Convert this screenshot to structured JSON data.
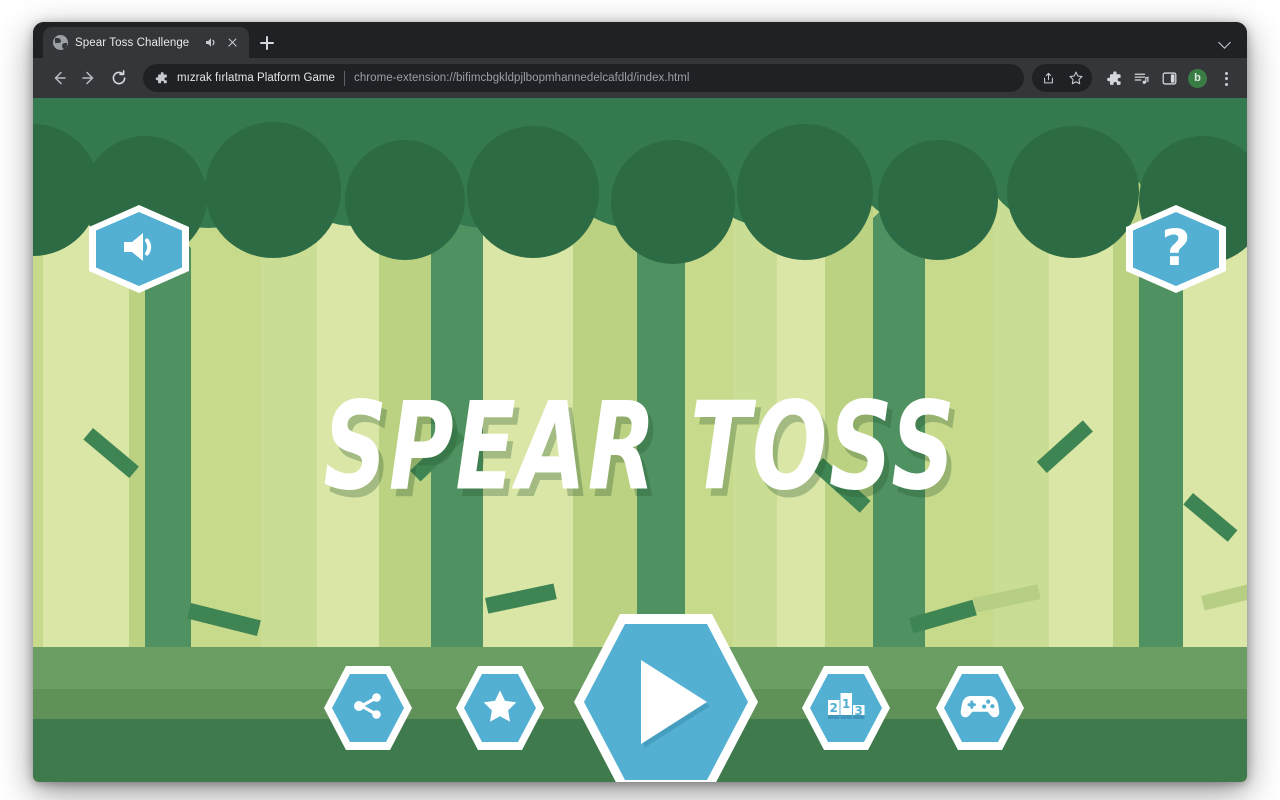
{
  "browser": {
    "tab": {
      "favicon": "globe-icon",
      "title": "Spear Toss Challenge",
      "audio_icon": "speaker-playing-icon",
      "close_icon": "close-icon"
    },
    "new_tab_label": "+",
    "tab_search_icon": "chevron-down-icon",
    "nav": {
      "back_icon": "arrow-left-icon",
      "forward_icon": "arrow-right-icon",
      "reload_icon": "reload-icon"
    },
    "omnibox": {
      "extension_icon": "puzzle-piece-icon",
      "extension_name": "mızrak fırlatma Platform Game",
      "separator": "|",
      "url": "chrome-extension://bifimcbgkldpjlbopmhannedelcafdld/index.html"
    },
    "actions": {
      "share_icon": "share-upload-icon",
      "bookmark_icon": "star-outline-icon",
      "extensions_icon": "puzzle-piece-icon",
      "reading_list_icon": "reading-list-icon",
      "side_panel_icon": "side-panel-icon",
      "profile_initial": "b",
      "menu_icon": "kebab-menu-icon"
    }
  },
  "game": {
    "title": "SPEAR TOSS",
    "buttons": {
      "sound": {
        "name": "sound-toggle",
        "icon": "speaker-volume-icon"
      },
      "help": {
        "name": "help-button",
        "label": "?"
      },
      "play": {
        "name": "play-button",
        "icon": "play-triangle-icon"
      },
      "share": {
        "name": "share-button",
        "icon": "share-nodes-icon"
      },
      "rate": {
        "name": "rate-button",
        "icon": "star-icon"
      },
      "leaderboard": {
        "name": "leaderboard-button",
        "icon": "podium-icon",
        "ranks": [
          "2",
          "1",
          "3"
        ]
      },
      "more_games": {
        "name": "more-games-button",
        "icon": "gamepad-icon"
      }
    },
    "colors": {
      "accent_blue": "#53b0d2",
      "button_border": "#ffffff",
      "canopy_dark": "#2c6b43",
      "canopy_mid": "#357a4f",
      "trunk_light": "#d5e59a",
      "trunk_mid": "#b9cf7f",
      "trunk_dark": "#4f9160",
      "ground_top": "#6a9e62",
      "ground_mid": "#5f9158",
      "ground_bottom": "#3f7a4c",
      "sky": "#7fd0ea"
    }
  }
}
